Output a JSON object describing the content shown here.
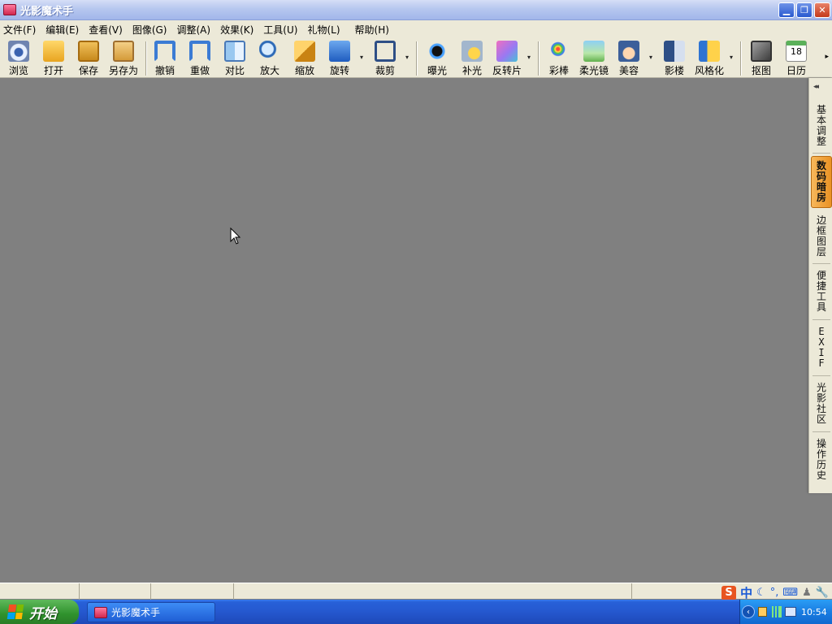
{
  "window": {
    "title": "光影魔术手",
    "minimize_glyph": "▁",
    "restore_glyph": "❐",
    "close_glyph": "✕"
  },
  "menu": [
    "文件(F)",
    "编辑(E)",
    "查看(V)",
    "图像(G)",
    "调整(A)",
    "效果(K)",
    "工具(U)",
    "礼物(L)",
    "帮助(H)"
  ],
  "toolbar": {
    "tools": [
      {
        "label": "浏览",
        "icon": "browse-icon"
      },
      {
        "label": "打开",
        "icon": "open-folder-icon"
      },
      {
        "label": "保存",
        "icon": "save-icon"
      },
      {
        "label": "另存为",
        "icon": "save-as-icon"
      },
      {
        "label": "撤销",
        "icon": "undo-icon"
      },
      {
        "label": "重做",
        "icon": "redo-icon"
      },
      {
        "label": "对比",
        "icon": "compare-icon"
      },
      {
        "label": "放大",
        "icon": "zoom-in-icon"
      },
      {
        "label": "缩放",
        "icon": "resize-icon"
      },
      {
        "label": "旋转",
        "icon": "rotate-icon"
      },
      {
        "label": "裁剪",
        "icon": "crop-icon"
      },
      {
        "label": "曝光",
        "icon": "exposure-icon"
      },
      {
        "label": "补光",
        "icon": "fill-light-icon"
      },
      {
        "label": "反转片",
        "icon": "reversal-film-icon"
      },
      {
        "label": "彩棒",
        "icon": "color-wand-icon"
      },
      {
        "label": "柔光镜",
        "icon": "soft-focus-icon"
      },
      {
        "label": "美容",
        "icon": "beauty-icon"
      },
      {
        "label": "影楼",
        "icon": "studio-icon"
      },
      {
        "label": "风格化",
        "icon": "stylize-icon"
      },
      {
        "label": "抠图",
        "icon": "cutout-icon"
      },
      {
        "label": "日历",
        "icon": "calendar-icon",
        "badge": "18"
      }
    ],
    "dropdown_glyph": "▾",
    "more_glyph": "▸"
  },
  "side_panel": {
    "collapse_glyph": "◂◂",
    "tabs": [
      {
        "label": "基本调整",
        "active": false
      },
      {
        "label": "数码暗房",
        "active": true
      },
      {
        "label": "边框图层",
        "active": false
      },
      {
        "label": "便捷工具",
        "active": false
      },
      {
        "label": "EXIF",
        "active": false
      },
      {
        "label": "光影社区",
        "active": false
      },
      {
        "label": "操作历史",
        "active": false
      }
    ]
  },
  "status_bar": {
    "ime": {
      "logo": "S",
      "mode": "中",
      "moon": "☾",
      "punct": "°,",
      "keyboard": "⌨",
      "user": "♟",
      "tool": "🔧"
    }
  },
  "taskbar": {
    "start_label": "开始",
    "task_title": "光影魔术手",
    "tray_arrow": "‹",
    "clock": "10:54"
  }
}
